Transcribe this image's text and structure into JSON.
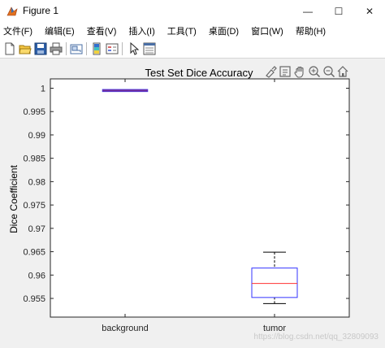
{
  "window": {
    "title": "Figure 1",
    "minimize_glyph": "—",
    "maximize_glyph": "☐",
    "close_glyph": "✕"
  },
  "menu": [
    {
      "label": "文件(F)"
    },
    {
      "label": "编辑(E)"
    },
    {
      "label": "查看(V)"
    },
    {
      "label": "插入(I)"
    },
    {
      "label": "工具(T)"
    },
    {
      "label": "桌面(D)"
    },
    {
      "label": "窗口(W)"
    },
    {
      "label": "帮助(H)"
    }
  ],
  "toolbar_icons": [
    "new-figure-icon",
    "open-file-icon",
    "save-icon",
    "print-icon",
    "link-plot-icon",
    "insert-colorbar-icon",
    "insert-legend-icon",
    "select-arrow-icon",
    "property-inspector-icon"
  ],
  "axes_toolbar_icons": [
    "brush-icon",
    "data-tips-icon",
    "pan-icon",
    "zoom-in-icon",
    "zoom-out-icon",
    "restore-view-icon"
  ],
  "watermark": "https://blog.csdn.net/qq_32809093",
  "colors": {
    "box_edge": "#3333ff",
    "median": "#ff3333",
    "whisker": "#000000",
    "collapsed_box": "#7030a0"
  },
  "chart_data": {
    "type": "box",
    "title": "Test Set Dice Accuracy",
    "xlabel": "",
    "ylabel": "Dice Coefficient",
    "ylim": [
      0.951,
      1.002
    ],
    "yticks": [
      0.955,
      0.96,
      0.965,
      0.97,
      0.975,
      0.98,
      0.985,
      0.99,
      0.995,
      1
    ],
    "ytick_labels": [
      "0.955",
      "0.96",
      "0.965",
      "0.97",
      "0.975",
      "0.98",
      "0.985",
      "0.99",
      "0.995",
      "1"
    ],
    "categories": [
      "background",
      "tumor"
    ],
    "boxes": [
      {
        "category": "background",
        "min": 0.9993,
        "q1": 0.9993,
        "median": 0.9994,
        "q3": 0.9995,
        "max": 0.9995
      },
      {
        "category": "tumor",
        "min": 0.9539,
        "q1": 0.9552,
        "median": 0.9582,
        "q3": 0.9615,
        "max": 0.9649
      }
    ],
    "grid": false,
    "legend": "none"
  }
}
